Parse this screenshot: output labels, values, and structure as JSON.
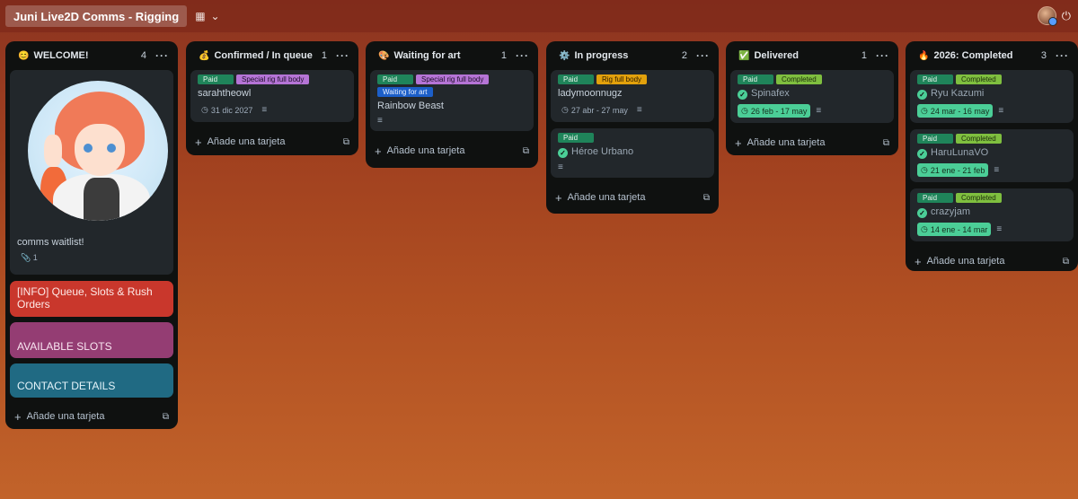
{
  "board": {
    "title": "Juni Live2D Comms - Rigging",
    "icon": "board-icon",
    "add_card_label": "Añade una tarjeta"
  },
  "colors": {
    "paid": "#1f845a",
    "special_rig": "#b574d6",
    "waiting_for_art": "#1c5fc9",
    "rig_full_body": "#e2a10c",
    "completed": "#7fbf3f",
    "info_red": "#c9372c",
    "info_purple": "#943d73",
    "info_teal": "#206a83"
  },
  "lists": {
    "welcome": {
      "emoji": "😊",
      "title": "WELCOME!",
      "count": "4",
      "cover_card_text": "comms waitlist!",
      "cover_attachments": "1",
      "info_card": "[INFO] Queue, Slots & Rush Orders",
      "slots_card": "AVAILABLE SLOTS",
      "contact_card": "CONTACT DETAILS"
    },
    "confirmed": {
      "emoji": "💰",
      "title": "Confirmed / In queue",
      "count": "1",
      "cards": [
        {
          "labels": [
            "Paid",
            "Special rig full body"
          ],
          "title": "sarahtheowl",
          "date": "31 dic 2027"
        }
      ]
    },
    "waiting": {
      "emoji": "🎨",
      "title": "Waiting for art",
      "count": "1",
      "cards": [
        {
          "labels": [
            "Paid",
            "Special rig full body",
            "Waiting for art"
          ],
          "title": "Rainbow Beast"
        }
      ]
    },
    "progress": {
      "emoji": "⚙️",
      "title": "In progress",
      "count": "2",
      "cards": [
        {
          "labels": [
            "Paid",
            "Rig full body"
          ],
          "title": "ladymoonnugz",
          "date": "27 abr - 27 may"
        },
        {
          "labels": [
            "Paid"
          ],
          "title": "Héroe Urbano"
        }
      ]
    },
    "delivered": {
      "emoji": "✅",
      "title": "Delivered",
      "count": "1",
      "cards": [
        {
          "labels": [
            "Paid",
            "Completed"
          ],
          "title": "Spinafex",
          "date": "26 feb - 17 may"
        }
      ]
    },
    "completed2026": {
      "emoji": "🔥",
      "title": "2026: Completed",
      "count": "3",
      "cards": [
        {
          "labels": [
            "Paid",
            "Completed"
          ],
          "title": "Ryu Kazumi",
          "date": "24 mar - 16 may"
        },
        {
          "labels": [
            "Paid",
            "Completed"
          ],
          "title": "HaruLunaVO",
          "date": "21 ene - 21 feb"
        },
        {
          "labels": [
            "Paid",
            "Completed"
          ],
          "title": "crazyjam",
          "date": "14 ene - 14 mar"
        }
      ]
    }
  }
}
